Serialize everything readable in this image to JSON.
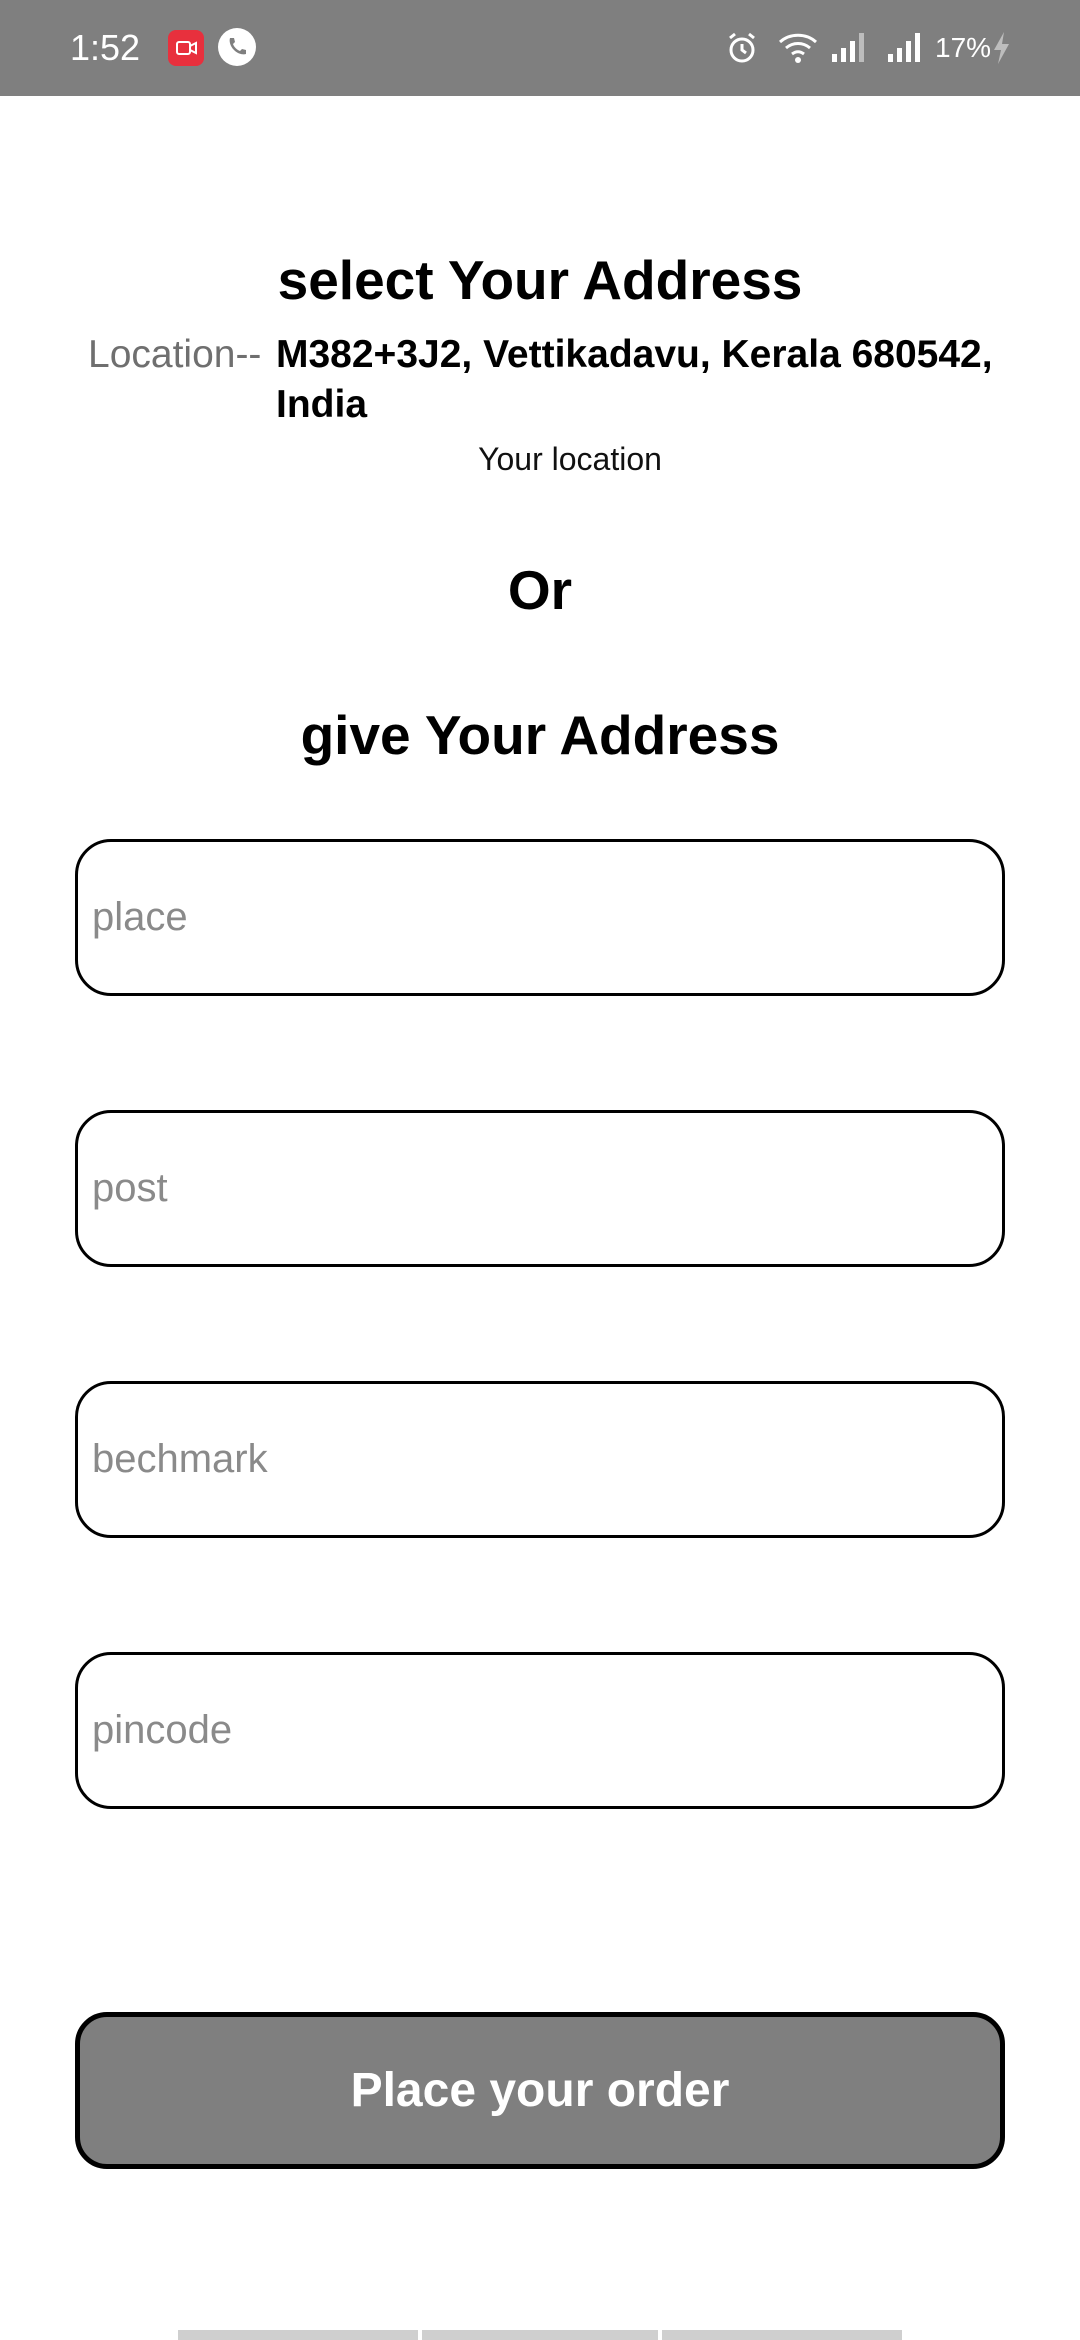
{
  "status_bar": {
    "time": "1:52",
    "battery": "17%",
    "icons": [
      "screen-record-icon",
      "phone-call-icon",
      "alarm-icon",
      "wifi-icon",
      "signal-icon",
      "signal-icon",
      "charging-bolt-icon"
    ]
  },
  "header": {
    "title": "select Your Address"
  },
  "location": {
    "label": "Location--",
    "value": "M382+3J2, Vettikadavu, Kerala 680542, India",
    "caption": "Your location"
  },
  "divider_text": "Or",
  "subtitle": "give Your Address",
  "form": {
    "place_placeholder": "place",
    "post_placeholder": "post",
    "benchmark_placeholder": "bechmark",
    "pincode_placeholder": "pincode"
  },
  "actions": {
    "order_label": "Place your order"
  },
  "colors": {
    "status_bar_bg": "#7f7f7f",
    "button_bg": "#7f7f7f",
    "record_badge": "#e8303d"
  }
}
